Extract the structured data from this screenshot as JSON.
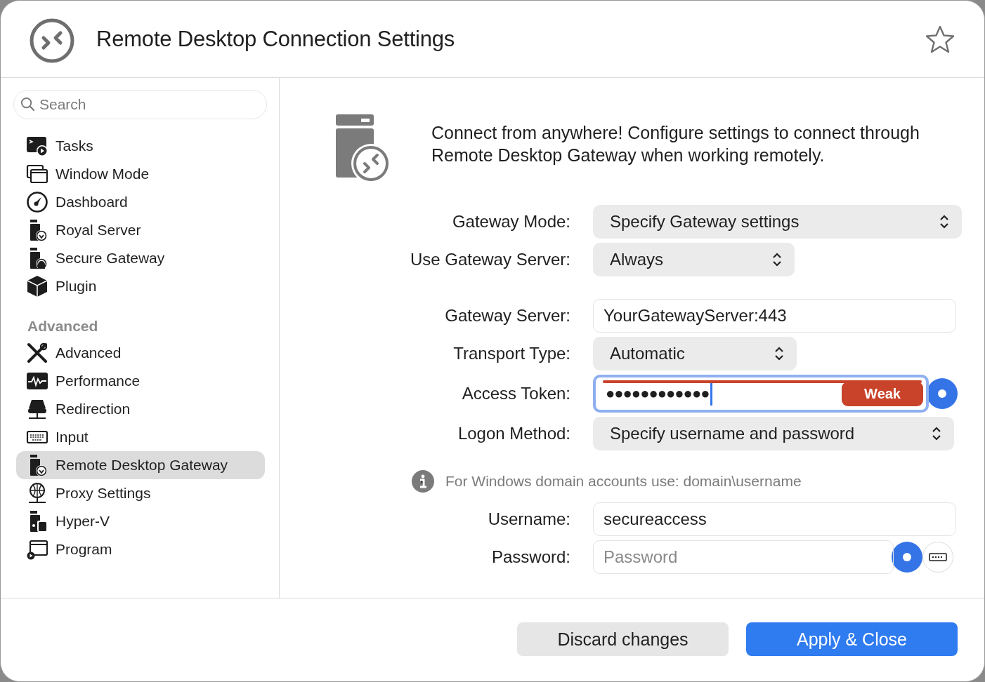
{
  "window": {
    "title": "Remote Desktop Connection Settings",
    "favorite": false
  },
  "sidebar": {
    "search": {
      "placeholder": "Search"
    },
    "sections": [
      {
        "items": [
          {
            "label": "Tasks",
            "selected": false
          },
          {
            "label": "Window Mode",
            "selected": false
          },
          {
            "label": "Dashboard",
            "selected": false
          },
          {
            "label": "Royal Server",
            "selected": false
          },
          {
            "label": "Secure Gateway",
            "selected": false
          },
          {
            "label": "Plugin",
            "selected": false
          }
        ]
      },
      {
        "heading": "Advanced",
        "items": [
          {
            "label": "Advanced",
            "selected": false
          },
          {
            "label": "Performance",
            "selected": false
          },
          {
            "label": "Redirection",
            "selected": false
          },
          {
            "label": "Input",
            "selected": false
          },
          {
            "label": "Remote Desktop Gateway",
            "selected": true
          },
          {
            "label": "Proxy Settings",
            "selected": false
          },
          {
            "label": "Hyper-V",
            "selected": false
          },
          {
            "label": "Program",
            "selected": false
          }
        ]
      }
    ]
  },
  "content": {
    "intro": "Connect from anywhere! Configure settings to connect through Remote Desktop Gateway when working remotely.",
    "form": [
      {
        "kind": "popup",
        "label": "Gateway Mode:",
        "value": "Specify Gateway settings"
      },
      {
        "kind": "popup",
        "label": "Use Gateway Server:",
        "value": "Always"
      },
      {
        "kind": "spacer"
      },
      {
        "kind": "text",
        "label": "Gateway Server:",
        "value": "YourGatewayServer:443"
      },
      {
        "kind": "popup",
        "label": "Transport Type:",
        "value": "Automatic"
      },
      {
        "kind": "secret",
        "label": "Access Token:",
        "value": "●●●●●●●●●●●●",
        "focused": true,
        "strength": "Weak"
      },
      {
        "kind": "popup",
        "label": "Logon Method:",
        "value": "Specify username and password"
      },
      {
        "kind": "note",
        "text": "For Windows domain accounts use: domain\\username"
      },
      {
        "kind": "text",
        "label": "Username:",
        "value": "secureaccess"
      },
      {
        "kind": "secret",
        "label": "Password:",
        "placeholder": "Password",
        "focused": false,
        "keyboard": true
      }
    ]
  },
  "buttons": [
    {
      "label": "Discard changes",
      "primary": false
    },
    {
      "label": "Apply & Close",
      "primary": true
    }
  ]
}
